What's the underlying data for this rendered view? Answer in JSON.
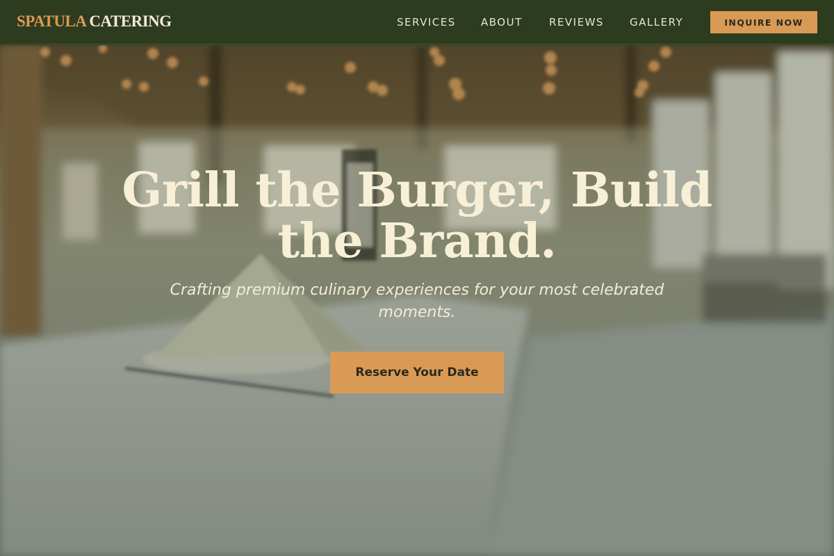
{
  "header": {
    "logo_part1": "SPATULA",
    "logo_part2": "CATERING",
    "nav": [
      {
        "label": "SERVICES"
      },
      {
        "label": "ABOUT"
      },
      {
        "label": "REVIEWS"
      },
      {
        "label": "GALLERY"
      }
    ],
    "cta_label": "INQUIRE NOW"
  },
  "hero": {
    "title": "Grill the Burger, Build the Brand.",
    "subtitle": "Crafting premium culinary experiences for your most celebrated moments.",
    "button_label": "Reserve Your Date"
  },
  "colors": {
    "header_bg": "#2d3b1e",
    "accent": "#d99a56",
    "cream": "#f7efd6"
  }
}
